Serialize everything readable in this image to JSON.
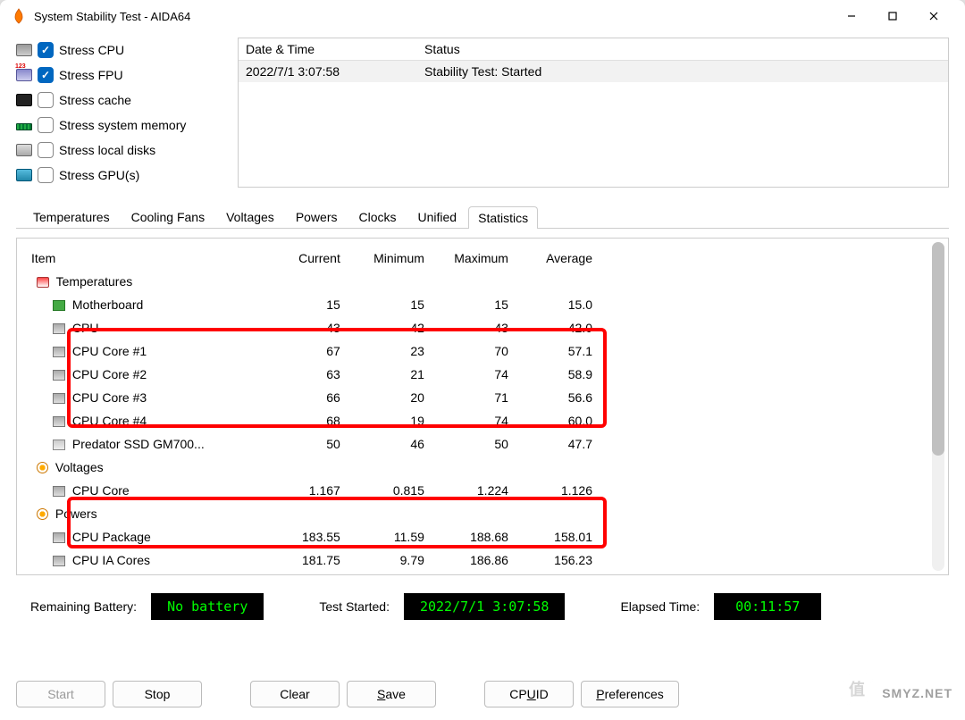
{
  "window": {
    "title": "System Stability Test - AIDA64"
  },
  "stress": {
    "items": [
      {
        "label": "Stress CPU",
        "checked": true,
        "iconCls": "hw-cpu"
      },
      {
        "label": "Stress FPU",
        "checked": true,
        "iconCls": "hw-fpu"
      },
      {
        "label": "Stress cache",
        "checked": false,
        "iconCls": "hw-cache"
      },
      {
        "label": "Stress system memory",
        "checked": false,
        "iconCls": "hw-mem"
      },
      {
        "label": "Stress local disks",
        "checked": false,
        "iconCls": "hw-disk"
      },
      {
        "label": "Stress GPU(s)",
        "checked": false,
        "iconCls": "hw-gpu"
      }
    ]
  },
  "log": {
    "headers": {
      "datetime": "Date & Time",
      "status": "Status"
    },
    "rows": [
      {
        "datetime": "2022/7/1 3:07:58",
        "status": "Stability Test: Started"
      }
    ]
  },
  "tabs": [
    "Temperatures",
    "Cooling Fans",
    "Voltages",
    "Powers",
    "Clocks",
    "Unified",
    "Statistics"
  ],
  "active_tab": "Statistics",
  "stats": {
    "headers": [
      "Item",
      "Current",
      "Minimum",
      "Maximum",
      "Average"
    ],
    "rows": [
      {
        "type": "group",
        "label": "Temperatures",
        "icon": "ic-temp"
      },
      {
        "type": "data",
        "label": "Motherboard",
        "icon": "ic-mobo",
        "c": "15",
        "mn": "15",
        "mx": "15",
        "av": "15.0"
      },
      {
        "type": "data",
        "label": "CPU",
        "icon": "ic-chip",
        "c": "43",
        "mn": "42",
        "mx": "43",
        "av": "42.0"
      },
      {
        "type": "data",
        "label": "CPU Core #1",
        "icon": "ic-chip",
        "c": "67",
        "mn": "23",
        "mx": "70",
        "av": "57.1"
      },
      {
        "type": "data",
        "label": "CPU Core #2",
        "icon": "ic-chip",
        "c": "63",
        "mn": "21",
        "mx": "74",
        "av": "58.9"
      },
      {
        "type": "data",
        "label": "CPU Core #3",
        "icon": "ic-chip",
        "c": "66",
        "mn": "20",
        "mx": "71",
        "av": "56.6"
      },
      {
        "type": "data",
        "label": "CPU Core #4",
        "icon": "ic-chip",
        "c": "68",
        "mn": "19",
        "mx": "74",
        "av": "60.0"
      },
      {
        "type": "data",
        "label": "Predator SSD GM700...",
        "icon": "ic-ssd",
        "c": "50",
        "mn": "46",
        "mx": "50",
        "av": "47.7"
      },
      {
        "type": "group",
        "label": "Voltages",
        "icon": "ic-volt"
      },
      {
        "type": "data",
        "label": "CPU Core",
        "icon": "ic-chip",
        "c": "1.167",
        "mn": "0.815",
        "mx": "1.224",
        "av": "1.126"
      },
      {
        "type": "group",
        "label": "Powers",
        "icon": "ic-pow"
      },
      {
        "type": "data",
        "label": "CPU Package",
        "icon": "ic-chip",
        "c": "183.55",
        "mn": "11.59",
        "mx": "188.68",
        "av": "158.01"
      },
      {
        "type": "data",
        "label": "CPU IA Cores",
        "icon": "ic-chip",
        "c": "181.75",
        "mn": "9.79",
        "mx": "186.86",
        "av": "156.23"
      }
    ]
  },
  "status": {
    "battery_label": "Remaining Battery:",
    "battery_val": "No battery",
    "started_label": "Test Started:",
    "started_val": "2022/7/1 3:07:58",
    "elapsed_label": "Elapsed Time:",
    "elapsed_val": "00:11:57"
  },
  "buttons": {
    "start": "Start",
    "stop": "Stop",
    "clear": "Clear",
    "save": "Save",
    "cpuid": "CPUID",
    "prefs": "Preferences"
  },
  "watermark": "SMYZ.NET"
}
